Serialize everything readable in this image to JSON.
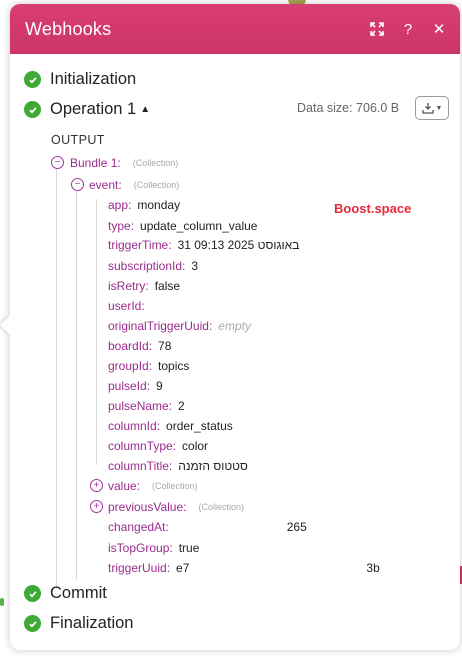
{
  "window": {
    "title": "Webhooks"
  },
  "header_icons": [
    "expand-icon",
    "help-icon",
    "close-icon"
  ],
  "steps": {
    "initialization": "Initialization",
    "operation": "Operation 1",
    "commit": "Commit",
    "finalization": "Finalization"
  },
  "data_size": "Data size: 706.0 B",
  "output_label": "OUTPUT",
  "watermark": "Boost.space",
  "bundle": {
    "key": "Bundle 1",
    "type": "(Collection)"
  },
  "event": {
    "key": "event",
    "type": "(Collection)"
  },
  "fields": [
    {
      "key": "app",
      "value": "monday"
    },
    {
      "key": "type",
      "value": "update_column_value"
    },
    {
      "key": "triggerTime",
      "value": "31 09:13 2025 באוגוסט"
    },
    {
      "key": "subscriptionId",
      "value": "3"
    },
    {
      "key": "isRetry",
      "value": "false"
    },
    {
      "key": "userId",
      "value": ""
    },
    {
      "key": "originalTriggerUuid",
      "value": "empty"
    },
    {
      "key": "boardId",
      "value": "78"
    },
    {
      "key": "groupId",
      "value": "topics"
    },
    {
      "key": "pulseId",
      "value": "9"
    },
    {
      "key": "pulseName",
      "value": "2"
    },
    {
      "key": "columnId",
      "value": "order_status"
    },
    {
      "key": "columnType",
      "value": "color"
    },
    {
      "key": "columnTitle",
      "value": "סטטוס הזמנה"
    }
  ],
  "value_coll": {
    "key": "value",
    "type": "(Collection)"
  },
  "previous_coll": {
    "key": "previousValue",
    "type": "(Collection)"
  },
  "tail_fields": [
    {
      "key": "changedAt",
      "value": "265"
    },
    {
      "key": "isTopGroup",
      "value": "true"
    },
    {
      "key": "triggerUuid",
      "value": "e7"
    },
    {
      "key": "triggerUuid_end",
      "value": "3b"
    }
  ],
  "colors": {
    "header": "#d13a6a",
    "check": "#3eaa35",
    "key": "#9b2c8e",
    "watermark": "#e8283b"
  }
}
